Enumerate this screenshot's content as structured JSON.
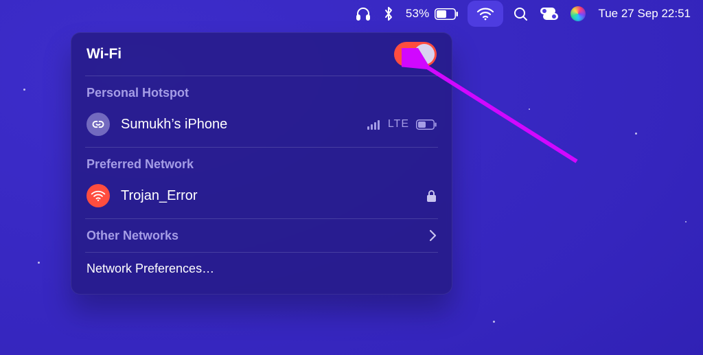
{
  "menubar": {
    "battery_percent": "53%",
    "clock": "Tue 27 Sep  22:51"
  },
  "panel": {
    "title": "Wi-Fi",
    "toggle_on": true,
    "personal_hotspot_label": "Personal Hotspot",
    "hotspot": {
      "name": "Sumukh’s iPhone",
      "network_type": "LTE"
    },
    "preferred_network_label": "Preferred Network",
    "preferred": {
      "name": "Trojan_Error",
      "locked": true
    },
    "other_networks_label": "Other Networks",
    "network_preferences_label": "Network Preferences…"
  }
}
